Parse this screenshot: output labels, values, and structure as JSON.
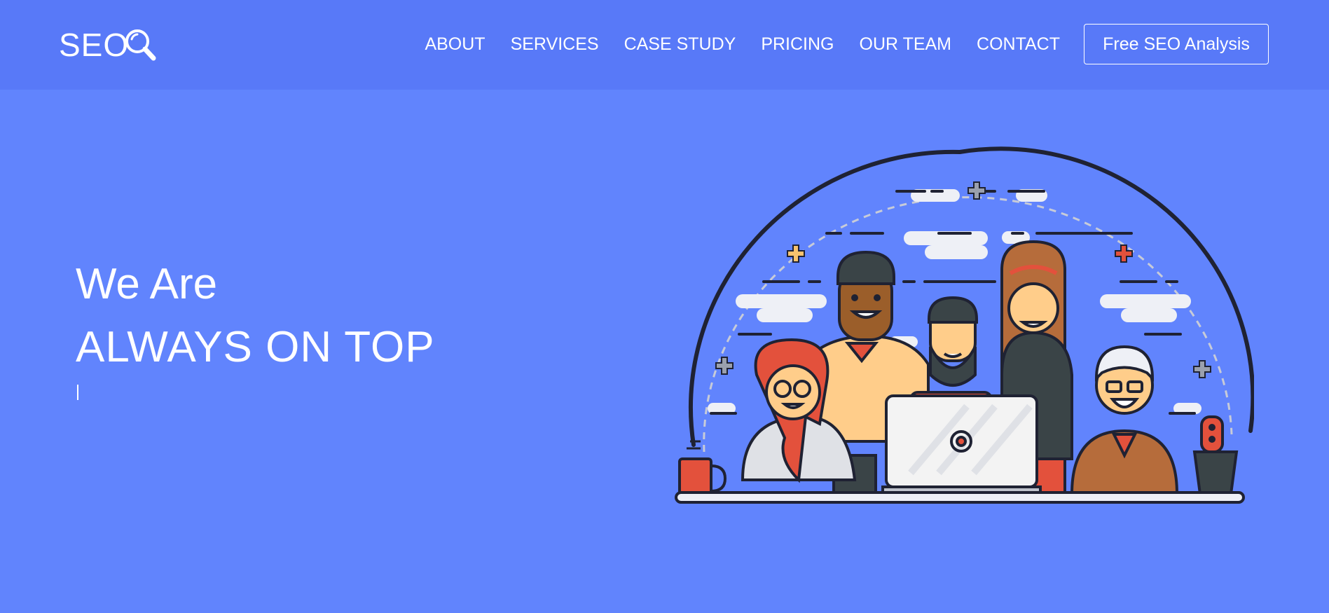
{
  "logo": {
    "text": "SEO",
    "icon": "magnifier-icon"
  },
  "nav": {
    "items": [
      "ABOUT",
      "SERVICES",
      "CASE STUDY",
      "PRICING",
      "OUR TEAM",
      "CONTACT"
    ]
  },
  "cta": {
    "label": "Free SEO Analysis"
  },
  "hero": {
    "line1": "We Are",
    "line2": "ALWAYS ON TOP"
  },
  "colors": {
    "background": "#6184fd",
    "header": "#5879f8",
    "text": "#ffffff"
  }
}
